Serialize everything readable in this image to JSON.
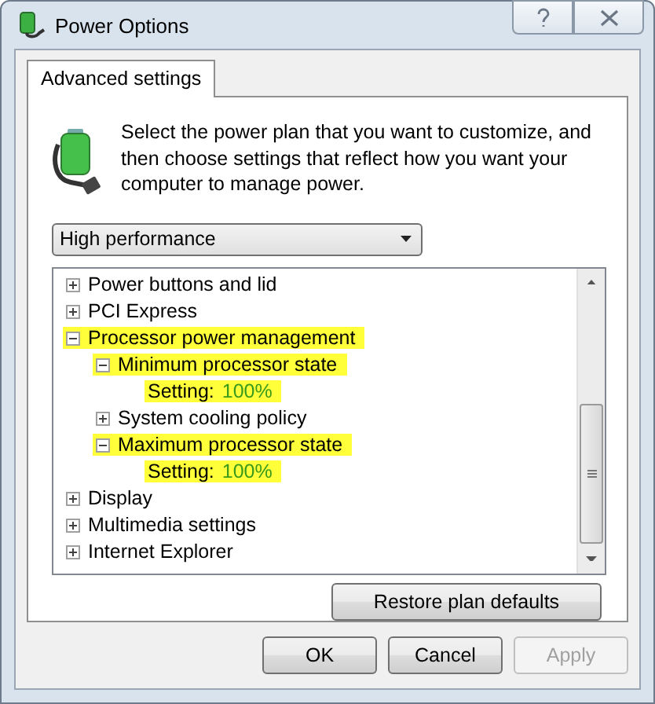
{
  "window": {
    "title": "Power Options"
  },
  "tabs": [
    {
      "label": "Advanced settings",
      "selected": true
    }
  ],
  "description": "Select the power plan that you want to customize, and then choose settings that reflect how you want your computer to manage power.",
  "plan_dropdown": {
    "value": "High performance"
  },
  "settings_tree": [
    {
      "kind": "group",
      "label": "Power buttons and lid",
      "expanded": false,
      "highlighted": false
    },
    {
      "kind": "group",
      "label": "PCI Express",
      "expanded": false,
      "highlighted": false
    },
    {
      "kind": "group",
      "label": "Processor power management",
      "expanded": true,
      "highlighted": true,
      "children": [
        {
          "kind": "group",
          "label": "Minimum processor state",
          "expanded": true,
          "highlighted": true,
          "children": [
            {
              "kind": "setting",
              "label": "Setting:",
              "value": "100%",
              "highlighted": true
            }
          ]
        },
        {
          "kind": "group",
          "label": "System cooling policy",
          "expanded": false,
          "highlighted": false
        },
        {
          "kind": "group",
          "label": "Maximum processor state",
          "expanded": true,
          "highlighted": true,
          "children": [
            {
              "kind": "setting",
              "label": "Setting:",
              "value": "100%",
              "highlighted": true
            }
          ]
        }
      ]
    },
    {
      "kind": "group",
      "label": "Display",
      "expanded": false,
      "highlighted": false
    },
    {
      "kind": "group",
      "label": "Multimedia settings",
      "expanded": false,
      "highlighted": false
    },
    {
      "kind": "group",
      "label": "Internet Explorer",
      "expanded": false,
      "highlighted": false
    }
  ],
  "restore_button": "Restore plan defaults",
  "buttons": [
    {
      "label": "OK",
      "disabled": false
    },
    {
      "label": "Cancel",
      "disabled": false
    },
    {
      "label": "Apply",
      "disabled": true
    }
  ]
}
